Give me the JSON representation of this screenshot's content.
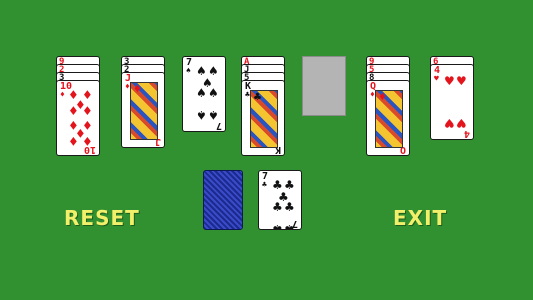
{
  "buttons": {
    "reset": "RESET",
    "exit": "EXIT"
  },
  "suits": {
    "hearts": "♥",
    "diamonds": "♦",
    "clubs": "♣",
    "spades": "♠"
  },
  "piles": [
    {
      "stubs": [
        {
          "rank": "9",
          "color": "red"
        },
        {
          "rank": "2",
          "color": "red"
        },
        {
          "rank": "3",
          "color": "black"
        }
      ],
      "top": {
        "rank": "10",
        "suit": "♦",
        "color": "red",
        "type": "pip"
      }
    },
    {
      "stubs": [
        {
          "rank": "3",
          "color": "black"
        },
        {
          "rank": "2",
          "color": "black"
        }
      ],
      "top": {
        "rank": "J",
        "suit": "♦",
        "color": "red",
        "type": "face"
      }
    },
    {
      "stubs": [],
      "top": {
        "rank": "7",
        "suit": "♠",
        "color": "black",
        "type": "pip"
      }
    },
    {
      "stubs": [
        {
          "rank": "A",
          "color": "red"
        },
        {
          "rank": "J",
          "color": "black"
        },
        {
          "rank": "5",
          "color": "black"
        }
      ],
      "top": {
        "rank": "K",
        "suit": "♣",
        "color": "black",
        "type": "face"
      }
    },
    {
      "stubs": [],
      "top": null,
      "empty": true
    },
    {
      "stubs": [
        {
          "rank": "9",
          "color": "red"
        },
        {
          "rank": "5",
          "color": "red"
        },
        {
          "rank": "8",
          "color": "black"
        }
      ],
      "top": {
        "rank": "Q",
        "suit": "♦",
        "color": "red",
        "type": "face"
      }
    },
    {
      "stubs": [
        {
          "rank": "6",
          "color": "red"
        }
      ],
      "top": {
        "rank": "4",
        "suit": "♥",
        "color": "red",
        "type": "pip"
      }
    }
  ],
  "stock": {
    "label": "deck"
  },
  "waste": {
    "rank": "7",
    "suit": "♣",
    "color": "black",
    "type": "pip"
  }
}
